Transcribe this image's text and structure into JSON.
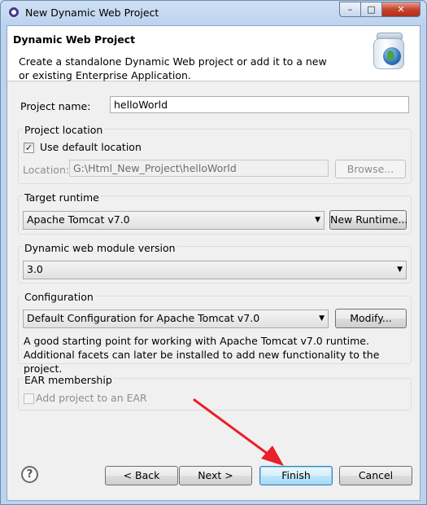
{
  "window": {
    "title": "New Dynamic Web Project",
    "controls": {
      "minimize": "–",
      "maximize": "□",
      "close": "✕"
    }
  },
  "banner": {
    "title": "Dynamic Web Project",
    "description": "Create a standalone Dynamic Web project or add it to a new or existing Enterprise Application."
  },
  "project_name": {
    "label": "Project name:",
    "value": "helloWorld"
  },
  "project_location": {
    "group_label": "Project location",
    "use_default_label": "Use default location",
    "use_default_checked": true,
    "location_label": "Location:",
    "location_value": "G:\\Html_New_Project\\helloWorld",
    "browse_label": "Browse..."
  },
  "target_runtime": {
    "group_label": "Target runtime",
    "selected": "Apache Tomcat v7.0",
    "new_runtime_label": "New Runtime..."
  },
  "module_version": {
    "group_label": "Dynamic web module version",
    "selected": "3.0"
  },
  "configuration": {
    "group_label": "Configuration",
    "selected": "Default Configuration for Apache Tomcat v7.0",
    "modify_label": "Modify...",
    "description": "A good starting point for working with Apache Tomcat v7.0 runtime. Additional facets can later be installed to add new functionality to the project."
  },
  "ear": {
    "group_label": "EAR membership",
    "add_label": "Add project to an EAR",
    "checked": false
  },
  "buttons": {
    "help": "?",
    "back": "< Back",
    "next": "Next >",
    "finish": "Finish",
    "cancel": "Cancel"
  },
  "colors": {
    "annotation_arrow": "#e8202a",
    "default_button_border": "#3c7fb1"
  },
  "icons": [
    "eclipse-app-icon",
    "web-project-jar-icon",
    "help-icon",
    "checkmark-icon",
    "dropdown-arrow-icon"
  ]
}
